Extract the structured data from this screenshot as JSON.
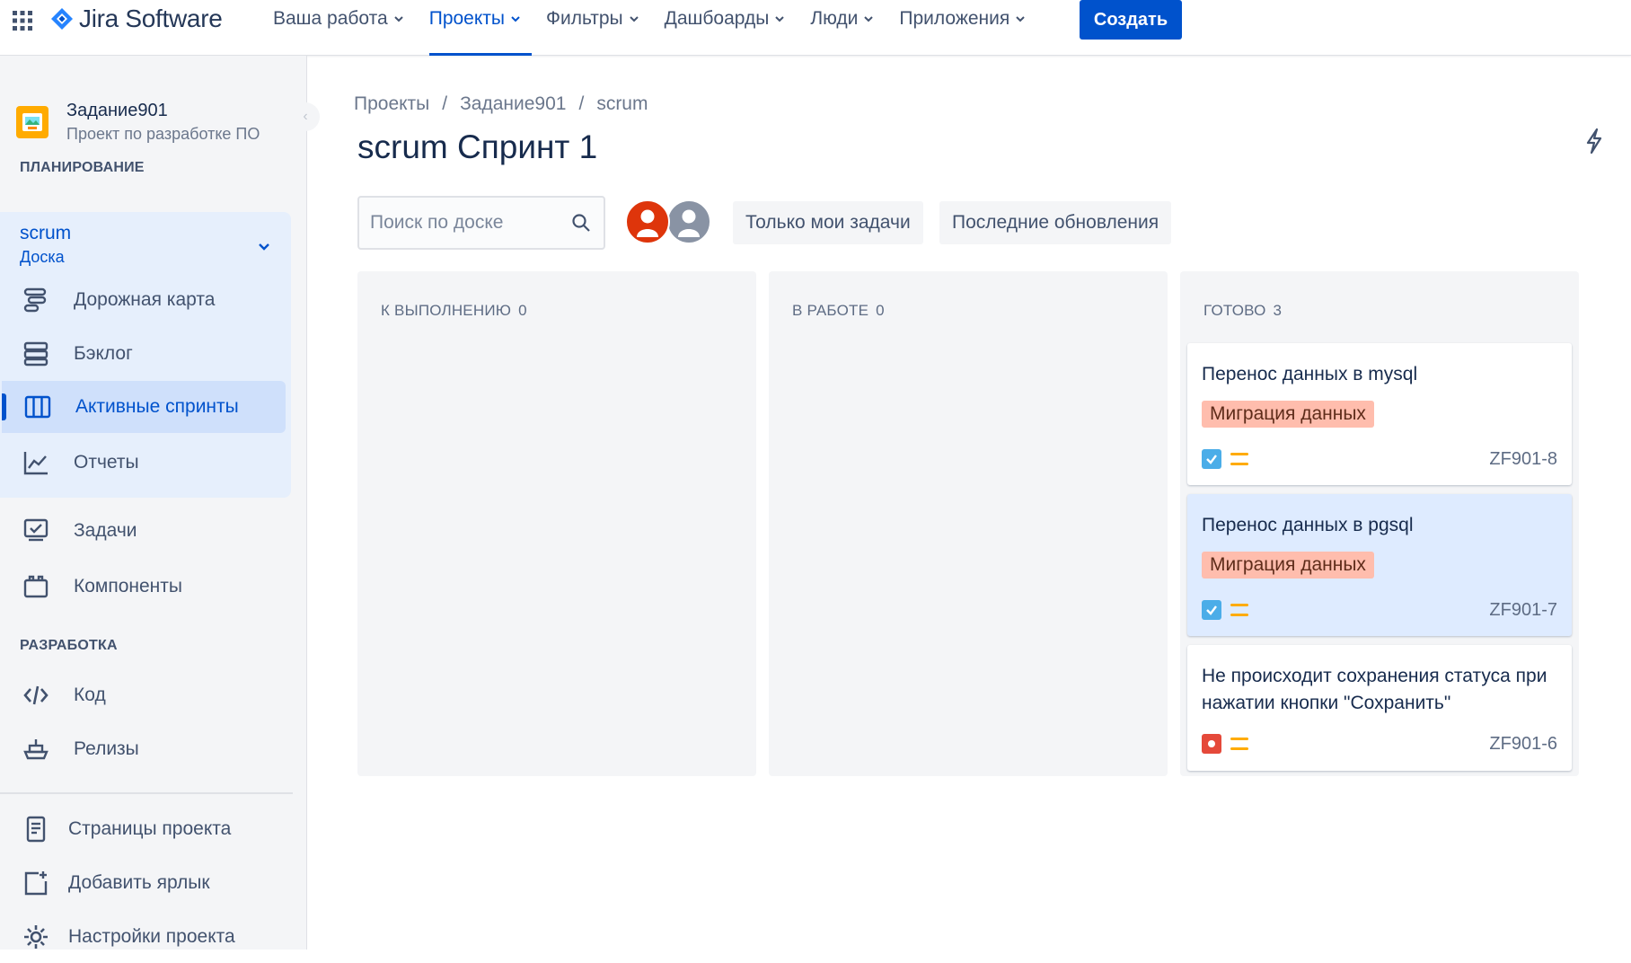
{
  "topnav": {
    "logo": "Jira Software",
    "items": [
      {
        "label": "Ваша работа"
      },
      {
        "label": "Проекты"
      },
      {
        "label": "Фильтры"
      },
      {
        "label": "Дашбоарды"
      },
      {
        "label": "Люди"
      },
      {
        "label": "Приложения"
      }
    ],
    "active_item": "Проекты",
    "create_label": "Создать",
    "accent_color": "#0052cc"
  },
  "sidebar": {
    "project_name": "Задание901",
    "project_type": "Проект по разработке ПО",
    "planning_title": "ПЛАНИРОВАНИЕ",
    "board": {
      "title": "scrum",
      "subtitle": "Доска"
    },
    "planning_items": [
      {
        "label": "Дорожная карта",
        "icon": "roadmap-icon"
      },
      {
        "label": "Бэклог",
        "icon": "backlog-icon"
      },
      {
        "label": "Активные спринты",
        "icon": "board-icon",
        "active": true
      },
      {
        "label": "Отчеты",
        "icon": "reports-icon"
      }
    ],
    "other_items": [
      {
        "label": "Задачи",
        "icon": "issues-icon"
      },
      {
        "label": "Компоненты",
        "icon": "components-icon"
      }
    ],
    "dev_title": "РАЗРАБОТКА",
    "dev_items": [
      {
        "label": "Код",
        "icon": "code-icon"
      },
      {
        "label": "Релизы",
        "icon": "releases-icon"
      }
    ],
    "bottom_items": [
      {
        "label": "Страницы проекта",
        "icon": "pages-icon"
      },
      {
        "label": "Добавить ярлык",
        "icon": "add-shortcut-icon"
      },
      {
        "label": "Настройки проекта",
        "icon": "settings-icon"
      }
    ]
  },
  "breadcrumb": [
    "Проекты",
    "Задание901",
    "scrum"
  ],
  "page_title": "scrum Спринт 1",
  "toolbar": {
    "search_placeholder": "Поиск по доске",
    "only_my_issues": "Только мои задачи",
    "recently_updated": "Последние обновления"
  },
  "columns": [
    {
      "title": "К ВЫПОЛНЕНИЮ",
      "count": "0",
      "cards": []
    },
    {
      "title": "В РАБОТЕ",
      "count": "0",
      "cards": []
    },
    {
      "title": "ГОТОВО",
      "count": "3",
      "cards": [
        {
          "title": "Перенос данных в mysql",
          "epic": "Миграция данных",
          "type": "task",
          "priority": "medium",
          "key": "ZF901-8"
        },
        {
          "title": "Перенос данных в pgsql",
          "epic": "Миграция данных",
          "type": "task",
          "priority": "medium",
          "key": "ZF901-7",
          "selected": true
        },
        {
          "title": "Не происходит сохранения статуса при нажатии кнопки \"Сохранить\"",
          "type": "bug",
          "priority": "medium",
          "key": "ZF901-6"
        }
      ]
    }
  ],
  "colors": {
    "task": "#4bade8",
    "bug": "#e5493a",
    "priority_medium": "#ffab00",
    "epic_bg": "#ffbdad"
  }
}
